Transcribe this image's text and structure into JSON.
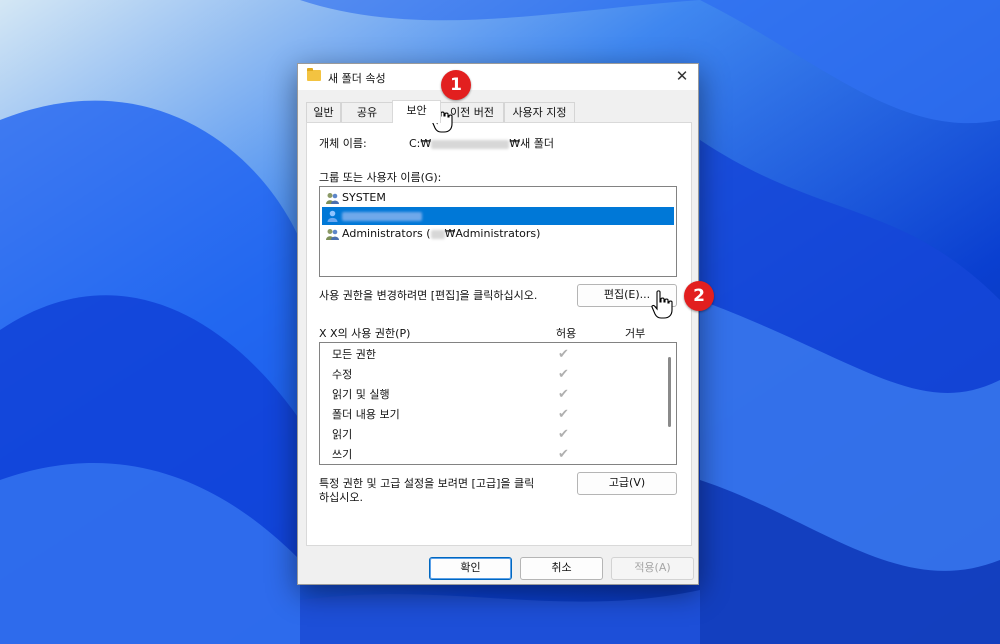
{
  "window": {
    "title": "새 폴더 속성",
    "close_glyph": "✕"
  },
  "tabs": [
    {
      "label": "일반"
    },
    {
      "label": "공유"
    },
    {
      "label": "보안"
    },
    {
      "label": "이전 버전"
    },
    {
      "label": "사용자 지정"
    }
  ],
  "security": {
    "object_name_label": "개체 이름:",
    "object_path_prefix": "C:₩",
    "object_path_suffix": "₩새 폴더",
    "group_label": "그룹 또는 사용자 이름(G):",
    "users": [
      {
        "name": "SYSTEM",
        "icon": "users-group-icon",
        "selected": false
      },
      {
        "name": "",
        "icon": "user-icon",
        "selected": true
      },
      {
        "name": "Administrators (",
        "suffix": "₩Administrators)",
        "icon": "users-group-icon",
        "selected": false
      }
    ],
    "change_hint": "사용 권한을 변경하려면 [편집]을 클릭하십시오.",
    "edit_button": "편집(E)...",
    "perm_label": "X X의 사용 권한(P)",
    "allow_header": "허용",
    "deny_header": "거부",
    "permissions": [
      {
        "name": "모든 권한",
        "allow": true
      },
      {
        "name": "수정",
        "allow": true
      },
      {
        "name": "읽기 및 실행",
        "allow": true
      },
      {
        "name": "폴더 내용 보기",
        "allow": true
      },
      {
        "name": "읽기",
        "allow": true
      },
      {
        "name": "쓰기",
        "allow": true
      }
    ],
    "advanced_hint_line1": "특정 권한 및 고급 설정을 보려면 [고급]을 클릭",
    "advanced_hint_line2": "하십시오.",
    "advanced_button": "고급(V)"
  },
  "footer": {
    "ok": "확인",
    "cancel": "취소",
    "apply": "적용(A)"
  },
  "annotations": {
    "step1": "1",
    "step2": "2"
  },
  "colors": {
    "accent": "#0078d7",
    "badge": "#e21f1f",
    "check": "#b0b0b0"
  }
}
